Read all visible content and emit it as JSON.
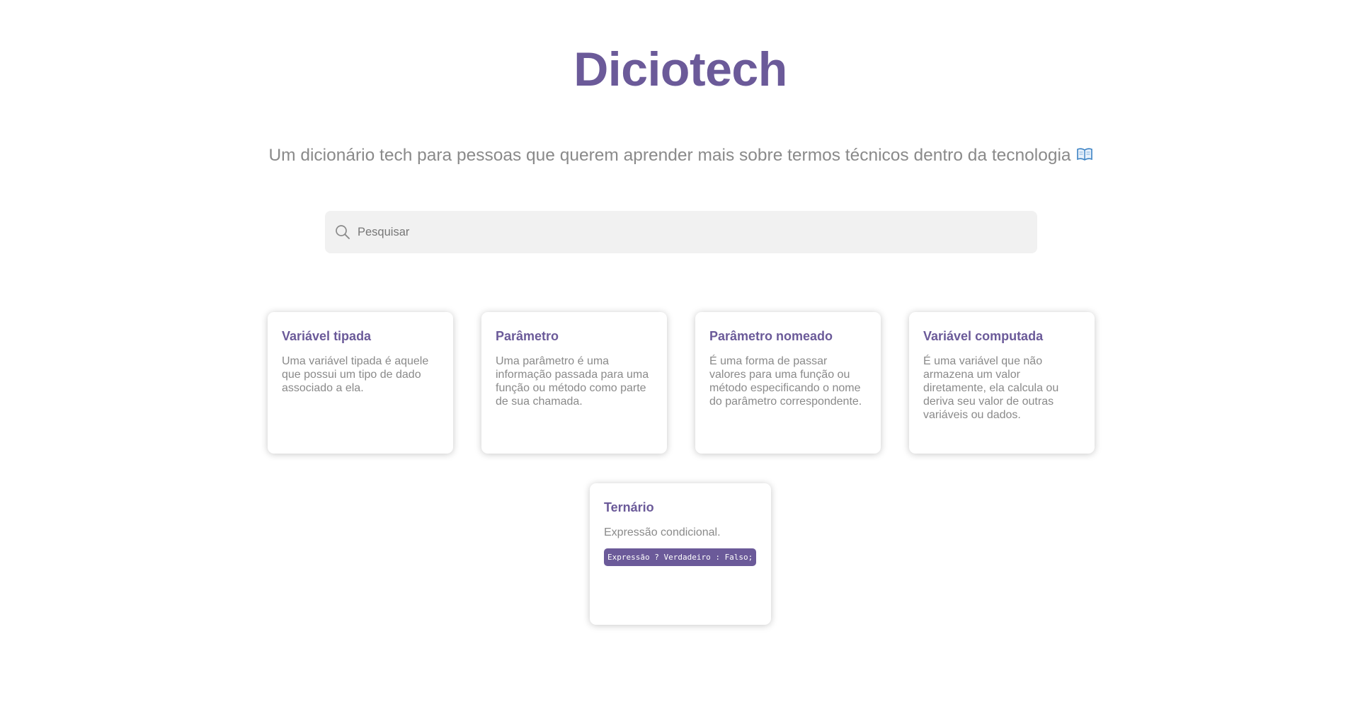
{
  "header": {
    "title": "Diciotech",
    "subtitle": "Um dicionário tech para pessoas que querem aprender mais sobre termos técnicos dentro da tecnologia",
    "subtitle_icon": "open-book-icon"
  },
  "search": {
    "placeholder": "Pesquisar",
    "value": "",
    "icon": "search-icon"
  },
  "cards": [
    {
      "title": "Variável tipada",
      "description": "Uma variável tipada é aquele que possui um tipo de dado associado a ela."
    },
    {
      "title": "Parâmetro",
      "description": "Uma parâmetro é uma informação passada para uma função ou método como parte de sua chamada."
    },
    {
      "title": "Parâmetro nomeado",
      "description": "É uma forma de passar valores para uma função ou método especificando o nome do parâmetro correspondente."
    },
    {
      "title": "Variável computada",
      "description": "É uma variável que não armazena um valor diretamente, ela calcula ou deriva seu valor de outras variáveis ou dados."
    },
    {
      "title": "Ternário",
      "description": "Expressão condicional.",
      "code": "Expressão ? Verdadeiro : Falso;"
    }
  ],
  "colors": {
    "accent": "#6b5a99",
    "muted_text": "#8a8a8a",
    "search_bg": "#f1f1f1"
  }
}
